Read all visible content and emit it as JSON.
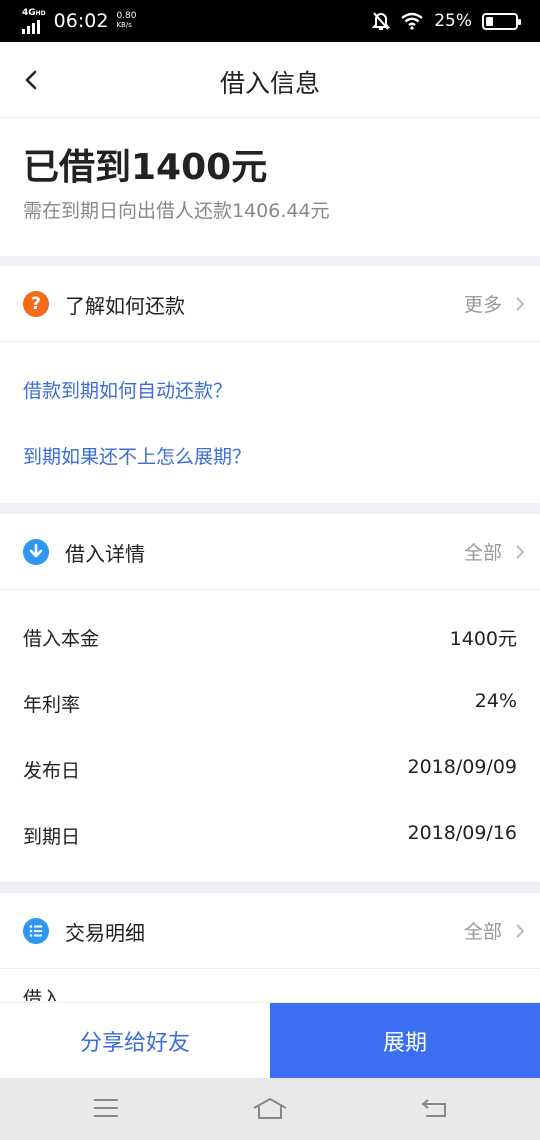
{
  "status_bar": {
    "network_type": "4G",
    "network_sub": "HD",
    "time": "06:02",
    "speed_value": "0.80",
    "speed_unit": "KB/s",
    "battery_percent": "25%",
    "battery_level": 0.25
  },
  "nav": {
    "title": "借入信息"
  },
  "summary": {
    "headline": "已借到1400元",
    "subtext": "需在到期日向出借人还款1406.44元"
  },
  "repay_card": {
    "icon": "question-icon",
    "icon_glyph": "?",
    "icon_color": "#f36a1b",
    "title": "了解如何还款",
    "more_label": "更多",
    "questions": [
      "借款到期如何自动还款？",
      "到期如果还不上怎么展期？"
    ]
  },
  "detail_card": {
    "icon": "download-arrow-icon",
    "icon_color": "#2e97ef",
    "title": "借入详情",
    "more_label": "全部",
    "rows": [
      {
        "label": "借入本金",
        "value": "1400元"
      },
      {
        "label": "年利率",
        "value": "24%"
      },
      {
        "label": "发布日",
        "value": "2018/09/09"
      },
      {
        "label": "到期日",
        "value": "2018/09/16"
      }
    ]
  },
  "transaction_card": {
    "icon": "list-icon",
    "icon_color": "#2e97ef",
    "title": "交易明细",
    "more_label": "全部",
    "first_item_partial": "借入"
  },
  "actions": {
    "share_label": "分享给好友",
    "extend_label": "展期"
  },
  "colors": {
    "accent_blue": "#3b6ef2",
    "link_blue": "#3d6ed8",
    "orange": "#f36a1b",
    "section_gap": "#eef0f4"
  }
}
